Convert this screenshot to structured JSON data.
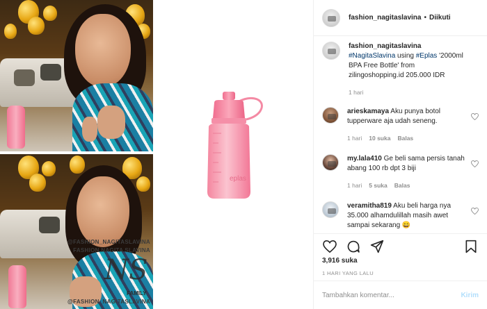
{
  "header": {
    "username": "fashion_nagitaslavina",
    "separator": "•",
    "follow_label": "Diikuti"
  },
  "caption": {
    "username": "fashion_nagitaslavina",
    "hashtag1": "#NagitaSlavina",
    "text1": "using",
    "hashtag2": "#Eplas",
    "text2": "'2000ml BPA Free Bottle' from zilingoshopping.id 205.000 IDR",
    "time": "1 hari"
  },
  "comments": [
    {
      "username": "arieskamaya",
      "text": "Aku punya botol tupperware aja udah seneng.",
      "time": "1 hari",
      "likes": "10 suka",
      "reply": "Balas"
    },
    {
      "username": "my.lala410",
      "text": "Ge beli sama persis tanah abang 100 rb dpt 3 biji",
      "time": "1 hari",
      "likes": "5 suka",
      "reply": "Balas"
    },
    {
      "username": "veramitha819",
      "text": "Aku beli harga nya 35.000 alhamdulillah masih awet sampai sekarang 😄",
      "time": "",
      "likes": "",
      "reply": ""
    }
  ],
  "likes_count": "3,916 suka",
  "post_date": "1 HARI YANG LALU",
  "add_comment": {
    "placeholder": "Tambahkan komentar...",
    "post_label": "Kirim"
  },
  "watermark": {
    "top_name": "@FASHION_NAGITASLAVINA",
    "name": "FASHION NAGITA SLAVINA",
    "initials": "NS",
    "family": "FAMILY",
    "bottom_name": "@FASHION_NAGITASLAVINA"
  },
  "bottle_label": "eplas",
  "colors": {
    "bottle_pink": "#f58fa8",
    "link": "#00376b",
    "secondary_text": "#8e8e8e",
    "post_button": "#b2dffc"
  }
}
